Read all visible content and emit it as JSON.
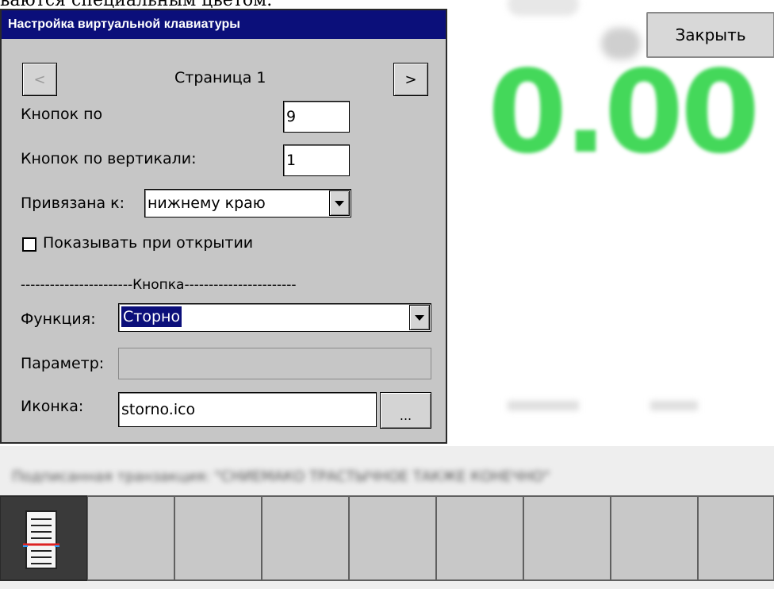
{
  "doc_top_text": "ваются специальным цветом.",
  "background": {
    "close_button_label": "Закрыть",
    "amount": "0.00",
    "blurred_text": "Подписанная транзакция: \"СНИЕМАКО ТРАСТЫЧНОЕ ТАКЖЕ КОНЕЧНО\"",
    "amount_color": "#44d85a"
  },
  "dialog": {
    "title": "Настройка виртуальной клавиатуры",
    "page_prev_label": "<",
    "page_label": "Страница 1",
    "page_next_label": ">",
    "buttons_label": "Кнопок по",
    "buttons_value": "9",
    "buttons_vertical_label": "Кнопок по вертикали:",
    "buttons_vertical_value": "1",
    "anchor_label": "Привязана к:",
    "anchor_value": "нижнему краю",
    "show_on_open_label": "Показывать при открытии",
    "show_on_open_checked": false,
    "section_label": "-----------------------Кнопка-----------------------",
    "function_label": "Функция:",
    "function_value": "Сторно",
    "parameter_label": "Параметр:",
    "parameter_value": "",
    "icon_label": "Иконка:",
    "icon_value": "storno.ico",
    "browse_label": "...",
    "title_bar_color": "#0b0f7a"
  },
  "keyboard": {
    "key_count": 9,
    "first_key_icon": "document-icon"
  }
}
